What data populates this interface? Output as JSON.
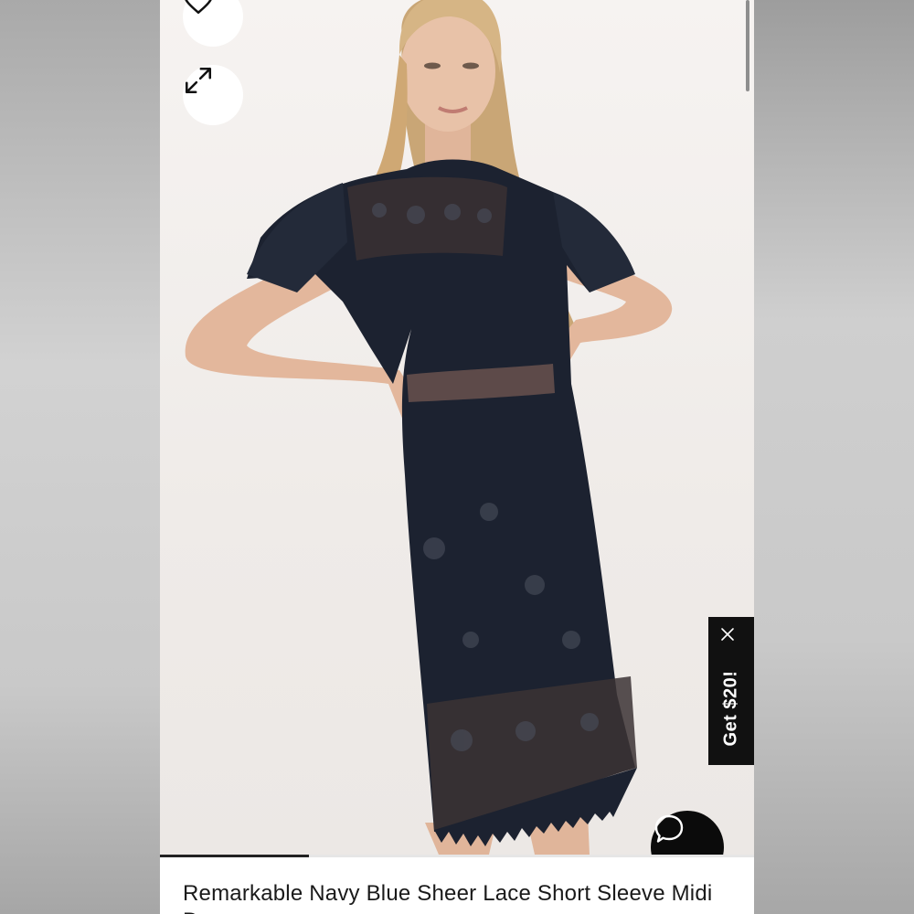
{
  "product": {
    "title": "Remarkable Navy Blue Sheer Lace Short Sleeve Midi Dress",
    "image_progress": 0.25
  },
  "actions": {
    "favorite_icon": "heart-icon",
    "expand_icon": "expand-arrows-icon"
  },
  "promo": {
    "label": "Get $20!",
    "close_icon": "close-icon"
  },
  "chat": {
    "icon": "chat-bubble-icon"
  },
  "colors": {
    "dress": "#1c2230",
    "promo_bg": "#111111",
    "chat_bg": "#0b0b0b"
  }
}
